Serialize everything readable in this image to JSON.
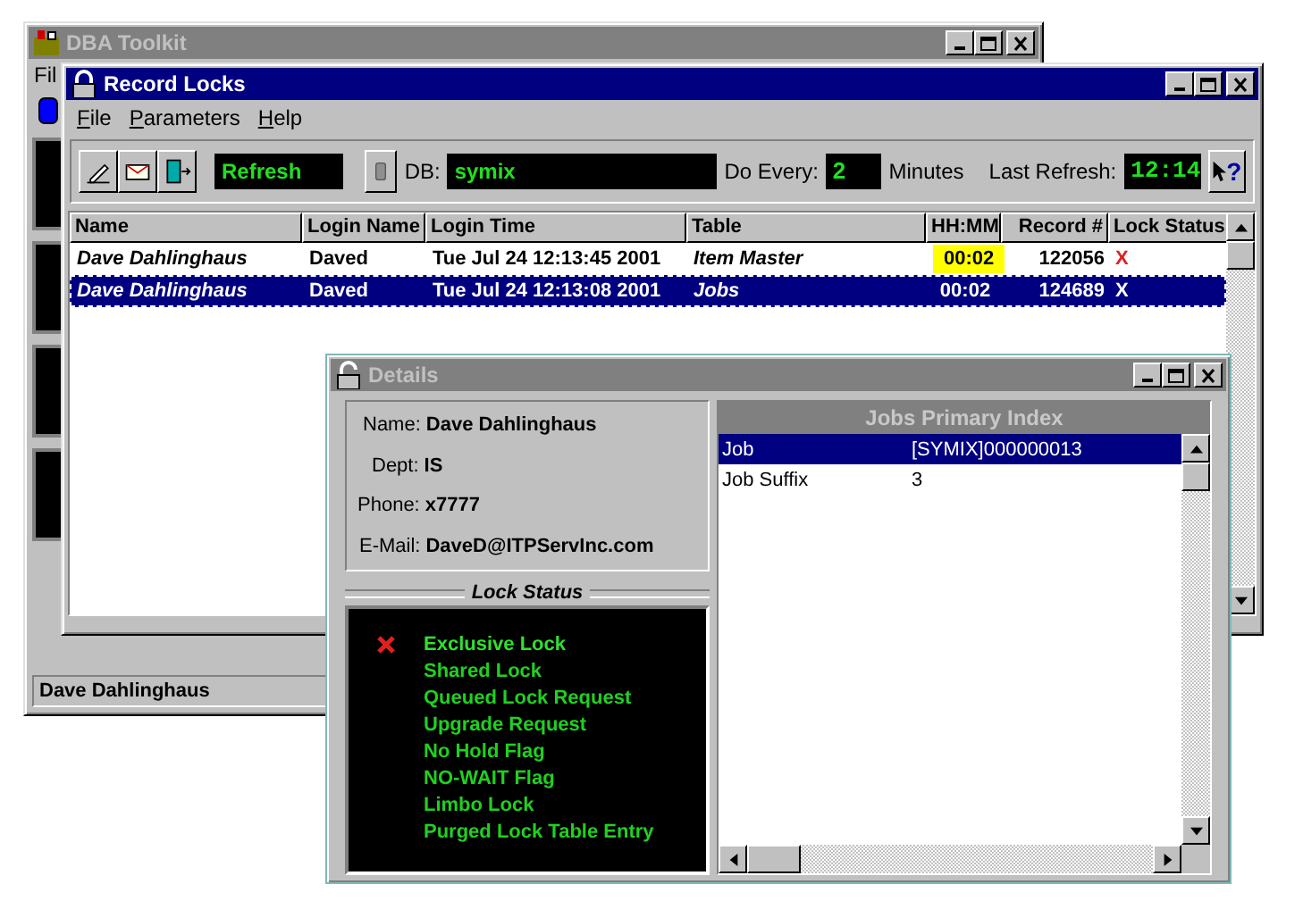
{
  "toolkit": {
    "title": "DBA Toolkit",
    "menu": [
      "Fil"
    ],
    "status_bar": "Dave Dahlinghaus"
  },
  "record_locks": {
    "title": "Record Locks",
    "menu": [
      "File",
      "Parameters",
      "Help"
    ],
    "toolbar": {
      "refresh": "Refresh",
      "db_label": "DB:",
      "db_value": "symix",
      "every_label": "Do Every:",
      "every_value": "2",
      "every_unit": "Minutes",
      "last_label": "Last Refresh:",
      "last_value": "12:14",
      "help": "?"
    },
    "table": {
      "columns": [
        "Name",
        "Login Name",
        "Login Time",
        "Table",
        "HH:MM",
        "Record #",
        "Lock Status"
      ],
      "rows": [
        {
          "selected": false,
          "highlighted": true,
          "cells": [
            "Dave Dahlinghaus",
            "Daved",
            "Tue Jul 24 12:13:45 2001",
            "Item Master",
            "00:02",
            "122056",
            "X"
          ]
        },
        {
          "selected": true,
          "highlighted": false,
          "cells": [
            "Dave Dahlinghaus",
            "Daved",
            "Tue Jul 24 12:13:08 2001",
            "Jobs",
            "00:02",
            "124689",
            "X"
          ]
        }
      ]
    }
  },
  "details": {
    "title": "Details",
    "info": [
      {
        "label": "Name:",
        "value": "Dave Dahlinghaus"
      },
      {
        "label": "Dept:",
        "value": "IS"
      },
      {
        "label": "Phone:",
        "value": "x7777"
      },
      {
        "label": "E-Mail:",
        "value": "DaveD@ITPServInc.com"
      }
    ],
    "lock_status": {
      "title": "Lock Status",
      "items": [
        {
          "label": "Exclusive Lock",
          "active": true
        },
        {
          "label": "Shared Lock",
          "active": false
        },
        {
          "label": "Queued Lock Request",
          "active": false
        },
        {
          "label": "Upgrade Request",
          "active": false
        },
        {
          "label": "No Hold Flag",
          "active": false
        },
        {
          "label": "NO-WAIT Flag",
          "active": false
        },
        {
          "label": "Limbo Lock",
          "active": false
        },
        {
          "label": "Purged Lock Table Entry",
          "active": false
        }
      ]
    },
    "index": {
      "title": "Jobs Primary Index",
      "rows": [
        {
          "field": "Job",
          "value": "[SYMIX]000000013",
          "selected": true
        },
        {
          "field": "Job Suffix",
          "value": "3",
          "selected": false
        }
      ]
    }
  }
}
